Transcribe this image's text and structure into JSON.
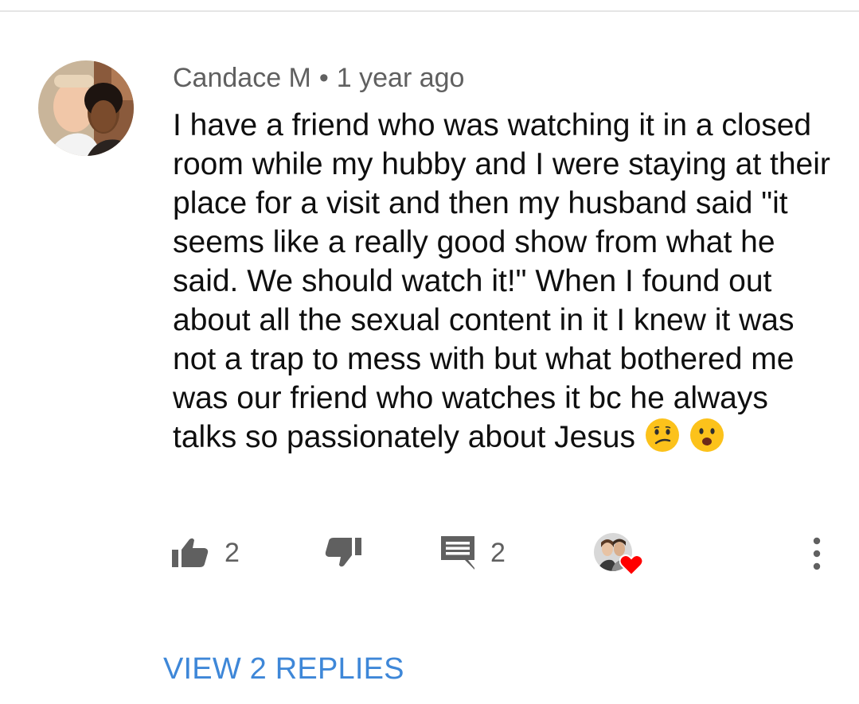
{
  "comment": {
    "author": "Candace M",
    "separator": "•",
    "timestamp": "1 year ago",
    "text": "I have a friend who was watching it in a closed room while my hubby and I were staying at their place for a visit and then my husband said \"it seems like a really good show from what he said. We should watch it!\" When I found out about all the sexual content in it I knew it was not a trap to mess with but what bothered me was our friend who watches it bc he always talks so passionately about Jesus",
    "emojis": [
      "confused-face",
      "frowning-open-mouth-face"
    ]
  },
  "actions": {
    "like_icon": "thumbs-up-icon",
    "like_count": "2",
    "dislike_icon": "thumbs-down-icon",
    "reply_icon": "comment-icon",
    "reply_count": "2",
    "creator_heart_icon": "heart-icon",
    "more_icon": "more-vertical-icon"
  },
  "replies": {
    "view_label": "VIEW 2 REPLIES"
  },
  "colors": {
    "link_blue": "#3e87d8",
    "meta_gray": "#606060",
    "heart_red": "#ff0000"
  }
}
